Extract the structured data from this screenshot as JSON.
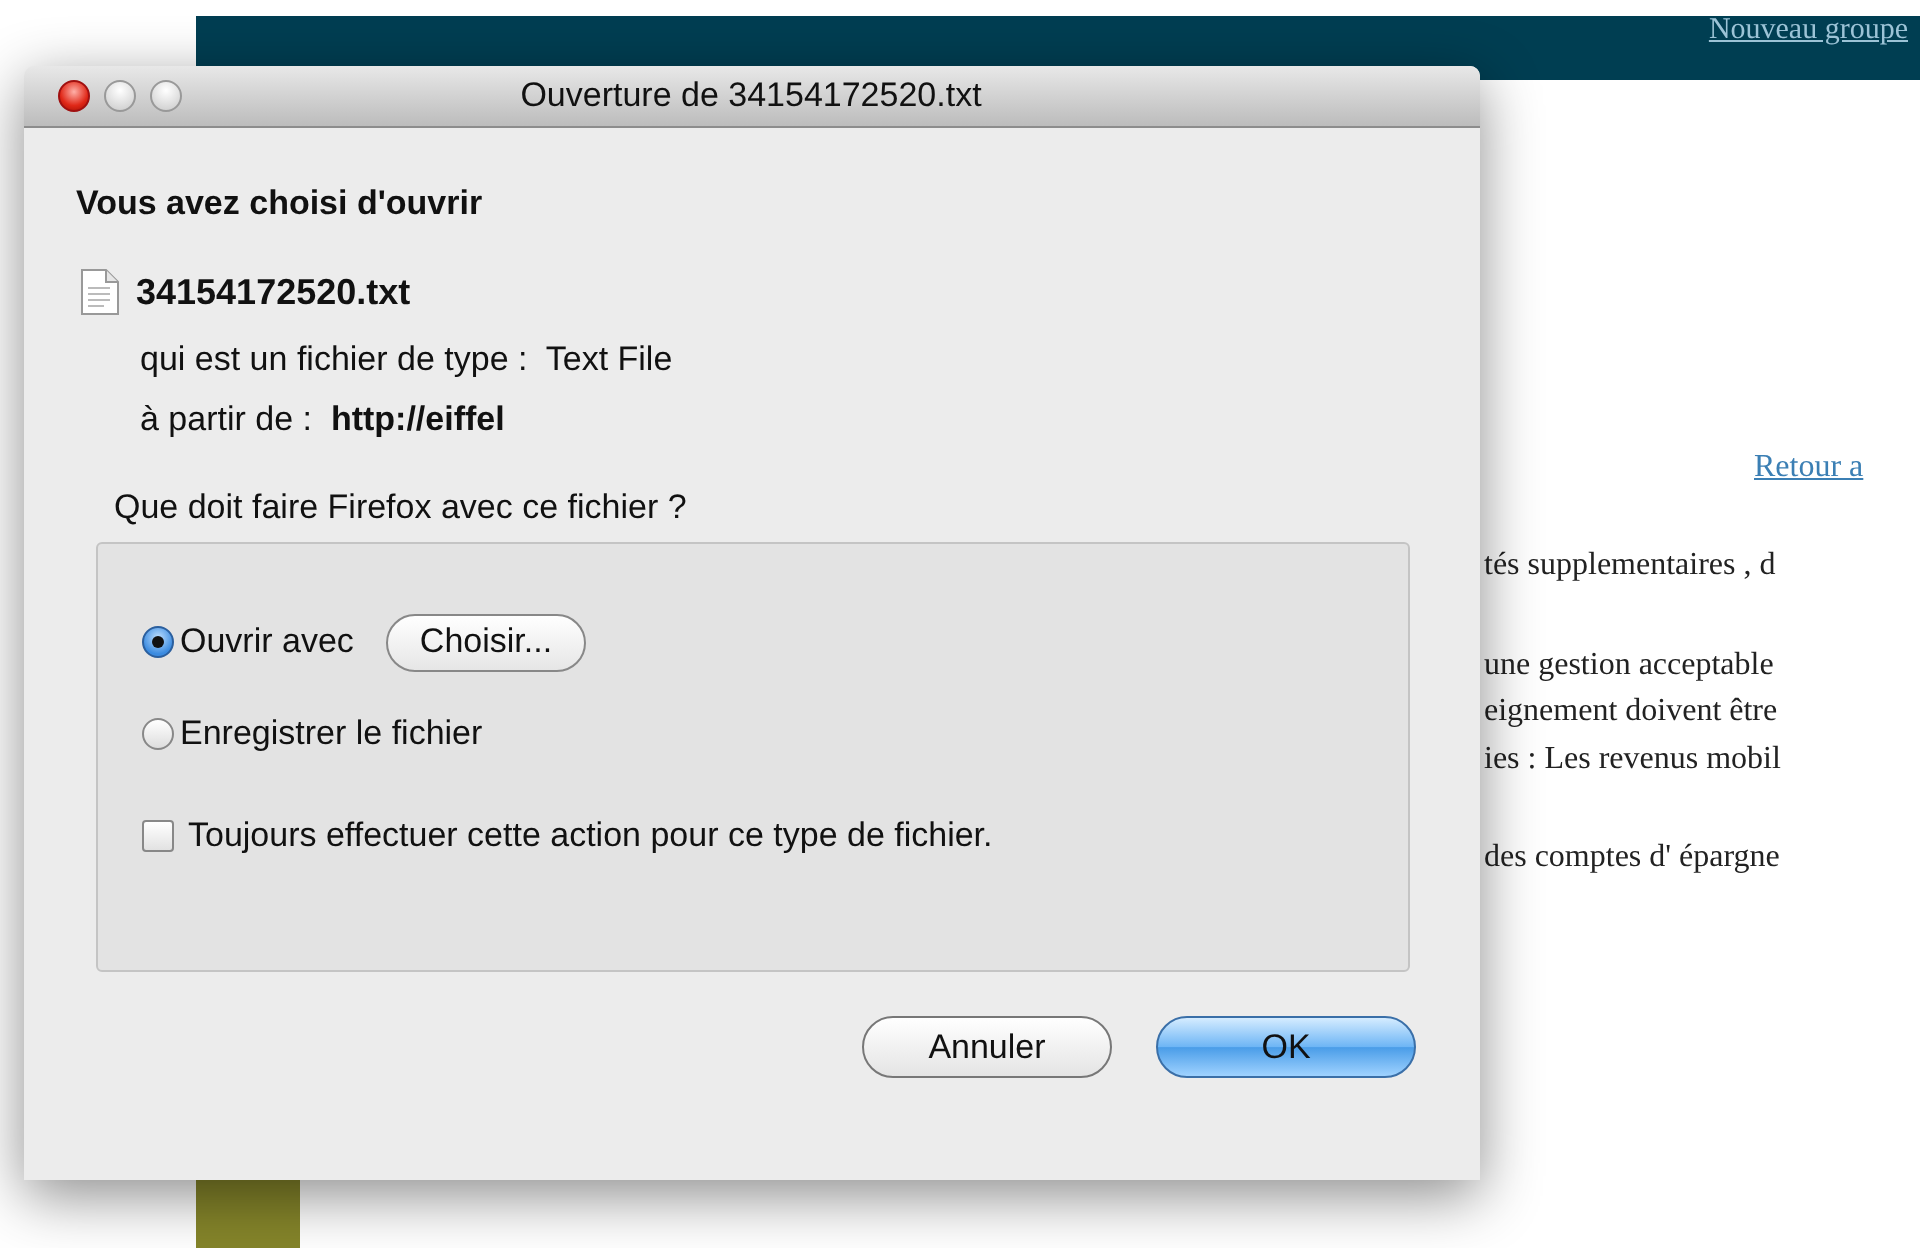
{
  "background_page": {
    "header_link": "Nouveau groupe",
    "link": "Retour a",
    "paragraphs": [
      {
        "text": "tés supplementaires , d"
      },
      {
        "text": "une gestion acceptable"
      },
      {
        "text": "eignement doivent être"
      },
      {
        "text": "ies : Les revenus mobil"
      },
      {
        "text": "des comptes d' épargne"
      }
    ]
  },
  "dialog": {
    "title": "Ouverture de 34154172520.txt",
    "window_controls": [
      {
        "kind": "close"
      },
      {
        "kind": "minimize"
      },
      {
        "kind": "zoom"
      }
    ],
    "heading": "Vous avez choisi d'ouvrir",
    "file_name": "34154172520.txt",
    "file_type_line": "qui est un fichier de type :  Text File",
    "source_line": "à partir de :  **http://eiffel**",
    "question": "Que doit faire Firefox avec ce fichier ?",
    "options": [
      {
        "label": "Ouvrir avec",
        "selected": true,
        "button": "Choisir..."
      },
      {
        "label": "Enregistrer le fichier",
        "selected": false
      }
    ],
    "always": {
      "label": "Toujours effectuer cette action pour ce type de fichier.",
      "checked": false
    },
    "buttons": [
      {
        "label": "Annuler",
        "default": false
      },
      {
        "label": "OK",
        "default": true
      }
    ]
  }
}
